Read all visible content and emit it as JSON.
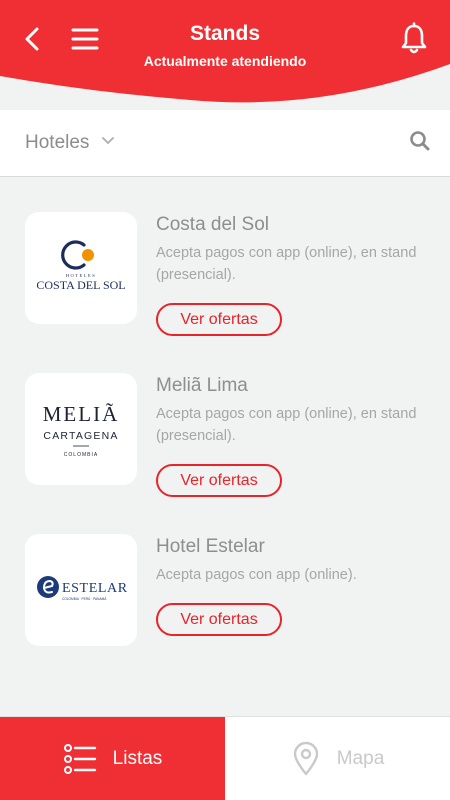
{
  "colors": {
    "brand_red": "#ef2f33",
    "text_gray": "#8e8e8e",
    "background": "#f1f2f2"
  },
  "header": {
    "title": "Stands",
    "subtitle": "Actualmente atendiendo",
    "icons": [
      "back-arrow-icon",
      "menu-icon",
      "bell-icon"
    ]
  },
  "filter": {
    "category_label": "Hoteles",
    "icons": [
      "chevron-down-icon",
      "search-icon"
    ]
  },
  "items": [
    {
      "name": "Costa del Sol",
      "description": "Acepta pagos con app (online), en stand (presencial).",
      "button_label": "Ver ofertas",
      "logo": {
        "line1": "HOTELES",
        "line2": "COSTA DEL SOL"
      }
    },
    {
      "name": "Meliã Lima",
      "description": "Acepta pagos con app (online), en stand (presencial).",
      "button_label": "Ver ofertas",
      "logo": {
        "line1": "MELIÃ",
        "line2": "CARTAGENA",
        "line3": "COLOMBIA"
      }
    },
    {
      "name": "Hotel Estelar",
      "description": "Acepta pagos con app (online).",
      "button_label": "Ver ofertas",
      "logo": {
        "line1": "ESTELAR",
        "line2": "COLOMBIA · PERÚ · PANAMÁ"
      }
    }
  ],
  "bottom_nav": {
    "tabs": [
      {
        "label": "Listas",
        "icon": "list-icon",
        "active": true
      },
      {
        "label": "Mapa",
        "icon": "map-pin-icon",
        "active": false
      }
    ]
  }
}
